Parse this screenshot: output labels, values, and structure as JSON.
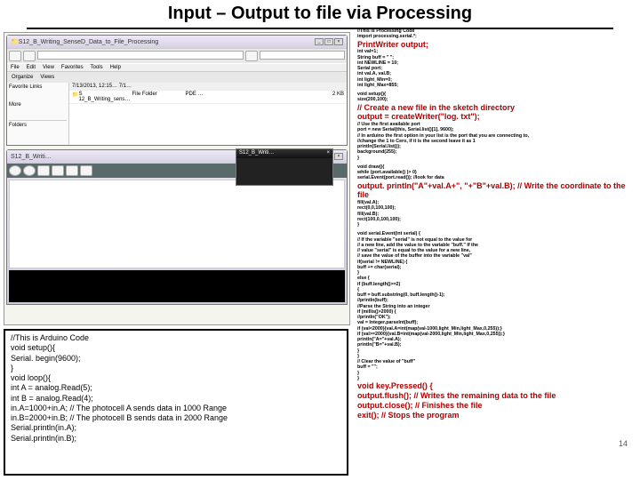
{
  "title": "Input – Output to file via Processing",
  "pagenum": "14",
  "browser": {
    "title_prefix": "S12_B_Writing_SenseD_Data_to_File_Processing",
    "menu": [
      "File",
      "Edit",
      "View",
      "Favorites",
      "Tools",
      "Help"
    ],
    "nav": {
      "back": "Back",
      "org": "Organize",
      "views": "Views"
    },
    "sidebar": {
      "fav": "Favorite Links",
      "more": "More",
      "folders": "Folders"
    },
    "listing": {
      "date": "7/13/2013, 12:15…   7/1…",
      "row1_name": "S 12_B_Writing_sens…",
      "row1_type": "File Folder",
      "row1_pde": "PDE …",
      "row1_size": "2 KB"
    }
  },
  "sketch": {
    "title": "S12_B_Writi…",
    "win_close": "×"
  },
  "arduino": {
    "l01": "//This is Arduino Code",
    "l02": "void setup(){",
    "l03": "  Serial. begin(9600);",
    "l04": "}",
    "l05": "void loop(){",
    "l06": "  int A = analog.Read(5);",
    "l07": "  int B = analog.Read(4);",
    "l08": "  in.A=1000+in.A; // The photocell A sends data in 1000 Range",
    "l09": "  in.B=2000+in.B; // The photocell B sends data in 2000 Range",
    "l10": "  Serial.println(in.A);",
    "l11": "  Serial.println(in.B);"
  },
  "proc": {
    "h01": "//This is Processing Code",
    "h02": "import processing.serial.*;",
    "h03": "PrintWriter output;",
    "h04": "int val=1;",
    "h05": "String buff = \" \";",
    "h06": "int NEWLINE = 10;",
    "h07": "Serial port;",
    "h08": "int val.A, val.B;",
    "h09": "int light_Min=0;",
    "h10": "int light_Max=855;",
    "s01": "void setup(){",
    "s02": "size(200,100);",
    "s03": "  // Create a new file in the sketch directory",
    "s04": "  output = createWriter(\"log. txt\");",
    "s05": "// Use the first available port",
    "s06": "port = new Serial(this, Serial.list()[1], 9600);",
    "s07": "// In arduino the first option in your list is the port that you are connecting to,",
    "s08": "//change the 1 to Cero, if it is the second leave it as 1",
    "s09": "println(Serial.list());",
    "s10": "background(255);",
    "s11": "}",
    "d01": "void draw(){",
    "d02": "  while (port.available() )> 0)",
    "d03": "   serial.Event(port.read()); //look for data",
    "d04": "  output. println(\"A\"+val.A+\", \"+\"B\"+val.B); // Write the coordinate to the file",
    "d05": "fill(val.A);",
    "d06": "rect(0,0,100,100);",
    "d07": "fill(val.B);",
    "d08": "rect(100,0,100,100);",
    "d09": "}",
    "e01": "void serial.Event(int serial) {",
    "e02": " // If the variable \"serial\" is not equal to the value for",
    "e03": " // a new line, add the value to the variable \"buff.\" If the",
    "e04": " // value \"serial\" is equal to the value for a new line,",
    "e05": " // save the value of the buffer into the variable \"val\"",
    "e06": " if(serial != NEWLINE) {",
    "e07": "  buff += char(serial);",
    "e08": " }",
    "e09": " else {",
    "e10": "  if (buff.length()>=2)",
    "e11": "  {",
    "e12": "   buff = buff.substring(0, buff.length()-1);",
    "e13": "   //println(buff);",
    "e14": "   //Parse the String into an integer",
    "e15": "   if (millis()>2000) {",
    "e16": "   //println(\"OK\");",
    "e17": "   val = Integer.parseInt(buff);",
    "e18": "   if (val<2000){val.A=int(map(val-1000,light_Min,light_Max,0,255));}",
    "e19": "   if (val>=2000){val.B=int(map(val-2000,light_Min,light_Max,0,255));}",
    "e20": "   println(\"A=\"+val.A);",
    "e21": "   println(\"B=\"+val.B);",
    "e22": "   }",
    "e23": "   }",
    "e24": "   // Clear the value of \"buff\"",
    "e25": "   buff = \"\";",
    "e26": "  }",
    "e27": "}",
    "k01": "void key.Pressed() {",
    "k02": "  output.flush(); // Writes the remaining data to the file",
    "k03": "  output.close(); // Finishes the file",
    "k04": "  exit(); // Stops the program"
  }
}
